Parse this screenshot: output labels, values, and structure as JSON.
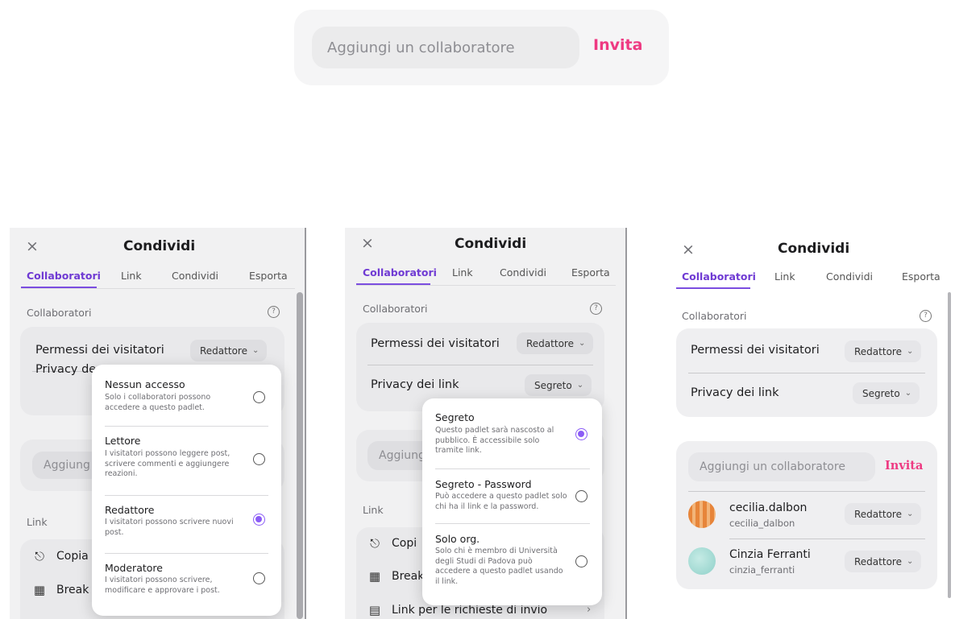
{
  "invite": {
    "placeholder": "Aggiungi un collaboratore",
    "button": "Invita"
  },
  "header": {
    "close": "×",
    "title": "Condividi",
    "tabs": [
      "Collaboratori",
      "Link",
      "Condividi",
      "Esporta"
    ]
  },
  "sections": {
    "collaborators_label": "Collaboratori",
    "help": "?",
    "link_label": "Link"
  },
  "settings": {
    "visitor_permissions_label": "Permessi dei visitatori",
    "visitor_permissions_value": "Redattore",
    "link_privacy_label": "Privacy dei link",
    "link_privacy_value": "Segreto"
  },
  "panel1": {
    "partial_privacy": "Privacy de",
    "partial_input": "Aggiung",
    "link_rows": [
      {
        "icon": "link-icon",
        "text": "Copia"
      },
      {
        "icon": "qr-icon",
        "text": "Break"
      }
    ],
    "permission_options": [
      {
        "title": "Nessun accesso",
        "desc": "Solo i collaboratori possono accedere a questo padlet.",
        "selected": false
      },
      {
        "title": "Lettore",
        "desc": "I visitatori possono leggere post, scrivere commenti e aggiungere reazioni.",
        "selected": false
      },
      {
        "title": "Redattore",
        "desc": "I visitatori possono scrivere nuovi post.",
        "selected": true
      },
      {
        "title": "Moderatore",
        "desc": "I visitatori possono scrivere, modificare e approvare i post.",
        "selected": false
      }
    ]
  },
  "panel2": {
    "partial_input": "Aggiung",
    "link_rows": [
      {
        "icon": "link-icon",
        "text": "Copi"
      },
      {
        "icon": "qr-icon",
        "text": "Break"
      },
      {
        "icon": "form-icon",
        "text": "Link per le richieste di invio"
      }
    ],
    "privacy_options": [
      {
        "title": "Segreto",
        "desc": "Questo padlet sarà nascosto al pubblico. È accessibile solo tramite link.",
        "selected": true
      },
      {
        "title": "Segreto - Password",
        "desc": "Può accedere a questo padlet solo chi ha il link e la password.",
        "selected": false
      },
      {
        "title": "Solo org.",
        "desc": "Solo chi è membro di Università degli Studi di Padova può accedere a questo padlet usando il link.",
        "selected": false
      }
    ]
  },
  "panel3": {
    "users": [
      {
        "name": "cecilia.dalbon",
        "handle": "cecilia_dalbon",
        "role": "Redattore",
        "avatar_color": "#e58a3c"
      },
      {
        "name": "Cinzia Ferranti",
        "handle": "cinzia_ferranti",
        "role": "Redattore",
        "avatar_color": "#9fd6d1"
      }
    ]
  },
  "colors": {
    "accent_purple": "#7b4de0",
    "invite_pink": "#ee3a82"
  }
}
